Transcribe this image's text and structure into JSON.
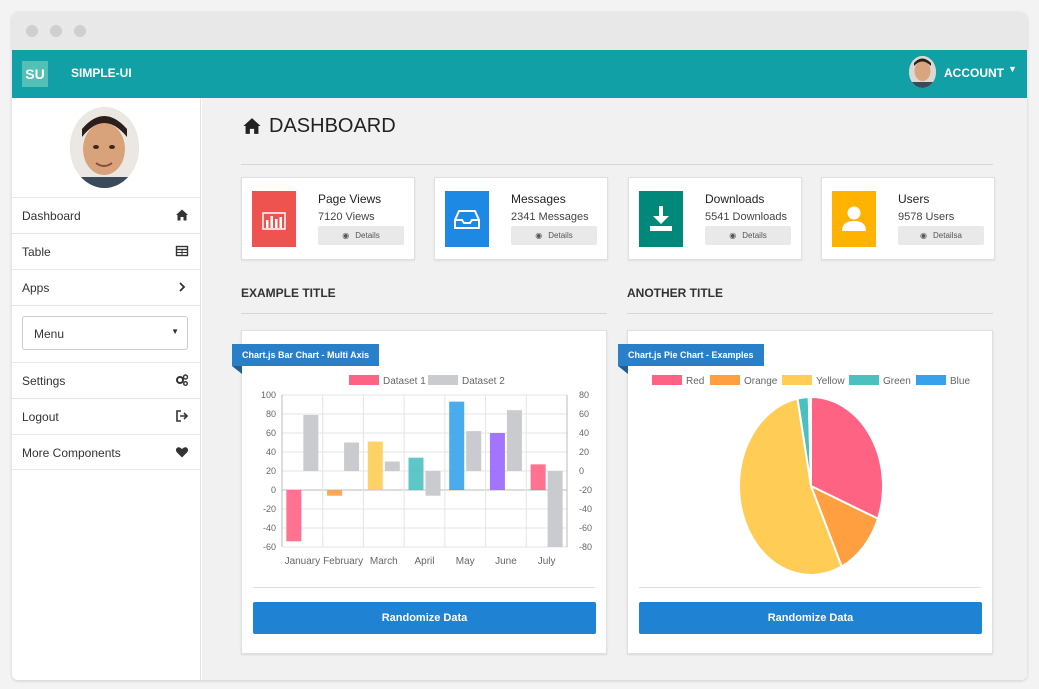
{
  "app": {
    "logo": "SU",
    "brand": "SIMPLE-UI"
  },
  "account": {
    "label": "ACCOUNT",
    "caret_icon": "caret-down-icon"
  },
  "sidebar": {
    "items": [
      {
        "label": "Dashboard",
        "icon": "home-icon"
      },
      {
        "label": "Table",
        "icon": "table-icon"
      },
      {
        "label": "Apps",
        "icon": "chevron-right-icon"
      }
    ],
    "menu_select": "Menu",
    "items2": [
      {
        "label": "Settings",
        "icon": "cogs-icon"
      },
      {
        "label": "Logout",
        "icon": "sign-out-icon"
      },
      {
        "label": "More Components",
        "icon": "heart-icon"
      }
    ]
  },
  "page": {
    "title": "DASHBOARD"
  },
  "stats": [
    {
      "title": "Page Views",
      "sub": "7120 Views",
      "details": "Details",
      "color": "#ef5350",
      "icon": "bar-chart-icon"
    },
    {
      "title": "Messages",
      "sub": "2341 Messages",
      "details": "Details",
      "color": "#1e88e5",
      "icon": "inbox-icon"
    },
    {
      "title": "Downloads",
      "sub": "5541 Downloads",
      "details": "Details",
      "color": "#00897b",
      "icon": "download-icon"
    },
    {
      "title": "Users",
      "sub": "9578 Users",
      "details": "Detailsa",
      "color": "#ffb300",
      "icon": "user-icon"
    }
  ],
  "sections": {
    "left_title": "EXAMPLE TITLE",
    "right_title": "ANOTHER TITLE"
  },
  "cards": {
    "bar": {
      "ribbon": "Chart.js Bar Chart - Multi Axis",
      "button": "Randomize Data"
    },
    "pie": {
      "ribbon": "Chart.js Pie Chart - Examples",
      "button": "Randomize Data"
    }
  },
  "chart_data": [
    {
      "type": "bar",
      "title": "",
      "categories": [
        "January",
        "February",
        "March",
        "April",
        "May",
        "June",
        "July"
      ],
      "series": [
        {
          "name": "Dataset 1",
          "axis": "left",
          "values": [
            -54,
            -6,
            51,
            34,
            93,
            60,
            27
          ],
          "colors": [
            "#ff6384",
            "#ff9f40",
            "#ffcd56",
            "#4bc0c0",
            "#36a2eb",
            "#9966ff",
            "#ff6384"
          ]
        },
        {
          "name": "Dataset 2",
          "axis": "right",
          "values": [
            59,
            30,
            10,
            -26,
            42,
            64,
            -80
          ],
          "colors": [
            "#c9cbcf"
          ]
        }
      ],
      "y_left": {
        "min": -60,
        "max": 100,
        "ticks": [
          100,
          80,
          60,
          40,
          20,
          0,
          -20,
          -40,
          -60
        ]
      },
      "y_right": {
        "min": -80,
        "max": 80,
        "ticks": [
          80,
          60,
          40,
          20,
          0,
          -20,
          -40,
          -60,
          -80
        ]
      },
      "legend": "top",
      "grid": true
    },
    {
      "type": "pie",
      "title": "",
      "labels": [
        "Red",
        "Orange",
        "Yellow",
        "Green",
        "Blue"
      ],
      "values": [
        31,
        12,
        54,
        2.5,
        0.5
      ],
      "colors": [
        "#ff6384",
        "#ff9f40",
        "#ffcd56",
        "#4bc0c0",
        "#36a2eb"
      ],
      "legend": "top"
    }
  ]
}
